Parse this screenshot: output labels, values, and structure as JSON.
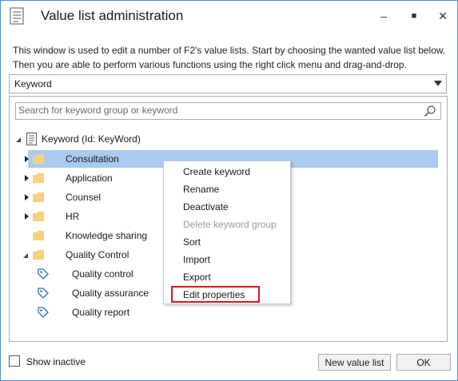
{
  "window": {
    "title": "Value list administration",
    "minimize_glyph": "–",
    "maximize_glyph": "■",
    "close_glyph": "✕"
  },
  "intro": {
    "line1": "This window is used to edit a number of F2's value lists. Start by choosing the wanted value list below.",
    "line2": "Then you are able to perform various functions using the right click menu and drag-and-drop."
  },
  "value_list_select": {
    "value": "Keyword"
  },
  "search": {
    "placeholder": "Search for keyword group or keyword"
  },
  "tree": {
    "root": {
      "label": "Keyword (Id: KeyWord)"
    },
    "groups": [
      {
        "label": "Consultation",
        "expandable": true,
        "selected": true
      },
      {
        "label": "Application",
        "expandable": true
      },
      {
        "label": "Counsel",
        "expandable": true
      },
      {
        "label": "HR",
        "expandable": true
      },
      {
        "label": "Knowledge sharing",
        "expandable": false
      },
      {
        "label": "Quality Control",
        "expanded": true
      }
    ],
    "keywords": [
      {
        "label": "Quality control"
      },
      {
        "label": "Quality assurance"
      },
      {
        "label": "Quality report"
      }
    ]
  },
  "context_menu": {
    "items": [
      {
        "label": "Create keyword",
        "enabled": true
      },
      {
        "label": "Rename",
        "enabled": true
      },
      {
        "label": "Deactivate",
        "enabled": true
      },
      {
        "label": "Delete keyword group",
        "enabled": false
      },
      {
        "label": "Sort",
        "enabled": true
      },
      {
        "label": "Import",
        "enabled": true
      },
      {
        "label": "Export",
        "enabled": true
      },
      {
        "label": "Edit properties",
        "enabled": true,
        "highlighted": true
      }
    ]
  },
  "footer": {
    "show_inactive_label": "Show inactive",
    "show_inactive_checked": false,
    "new_value_list_label": "New value list",
    "ok_label": "OK"
  },
  "colors": {
    "selection": "#a8cbef",
    "highlight_border": "#e0141e",
    "folder": "#f5d27a",
    "window_border": "#4f8fd6"
  }
}
